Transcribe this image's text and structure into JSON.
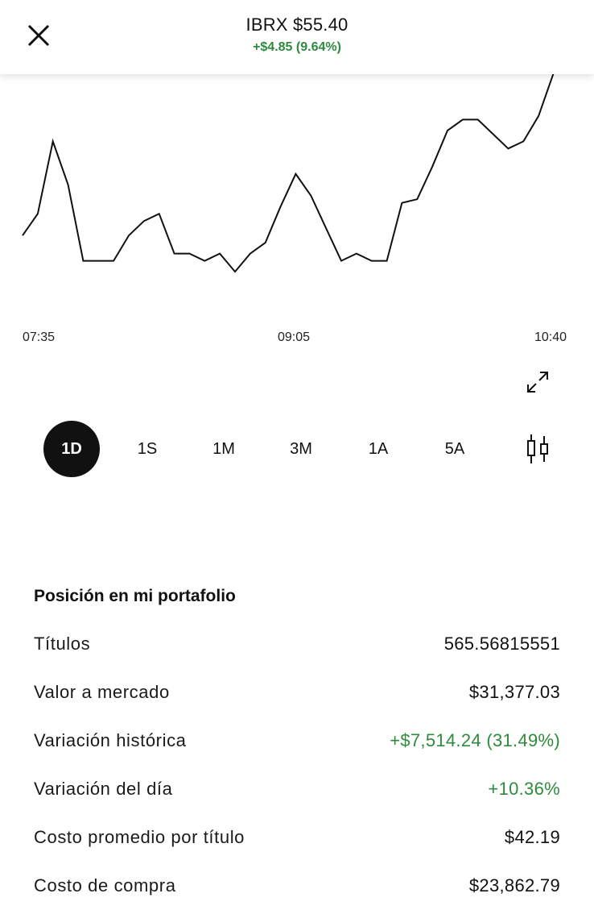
{
  "header": {
    "symbol_price": "IBRX $55.40",
    "change": "+$4.85 (9.64%)",
    "change_color": "#2e8b3d"
  },
  "chart": {
    "x_ticks": [
      "07:35",
      "09:05",
      "10:40"
    ],
    "y_values": [
      60,
      66,
      86,
      74,
      53,
      53,
      53,
      60,
      64,
      66,
      55,
      55,
      53,
      55,
      50,
      55,
      58,
      68,
      77,
      71,
      62,
      53,
      55,
      53,
      53,
      69,
      70,
      79,
      89,
      92,
      92,
      88,
      84,
      86,
      93,
      105
    ]
  },
  "periods": {
    "items": [
      "1D",
      "1S",
      "1M",
      "3M",
      "1A",
      "5A"
    ],
    "selected": "1D"
  },
  "portfolio": {
    "title": "Posición en mi portafolio",
    "rows": [
      {
        "label": "Títulos",
        "value": "565.56815551"
      },
      {
        "label": "Valor a mercado",
        "value": "$31,377.03"
      },
      {
        "label": "Variación histórica",
        "value": "+$7,514.24 (31.49%)"
      },
      {
        "label": "Variación del día",
        "value": "+10.36%"
      },
      {
        "label": "Costo promedio por título",
        "value": "$42.19"
      },
      {
        "label": "Costo de compra",
        "value": "$23,862.79"
      }
    ]
  },
  "icons": {
    "close": "close-icon",
    "expand": "expand-icon",
    "candlestick": "candlestick-icon"
  },
  "colors": {
    "positive": "#2e8b3d",
    "accent_dark": "#111111"
  }
}
